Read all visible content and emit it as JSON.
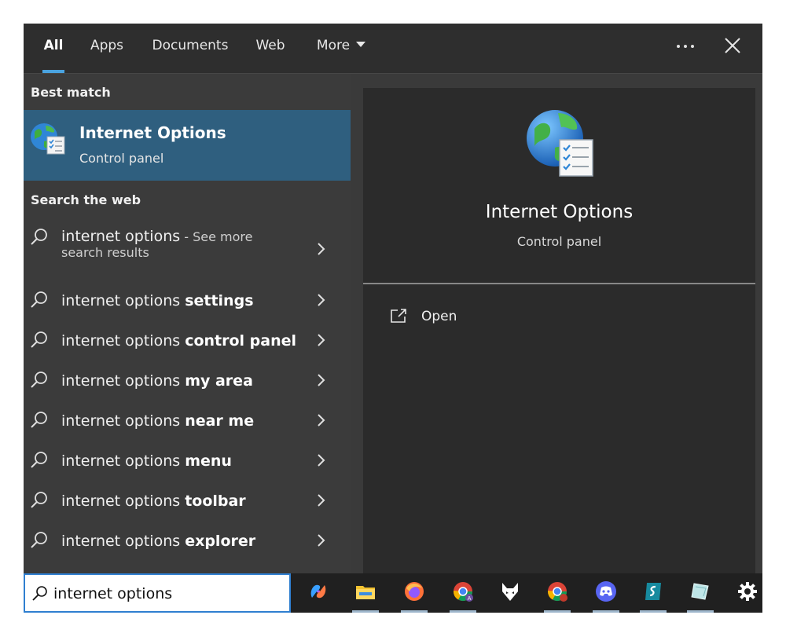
{
  "tabs": [
    {
      "label": "All",
      "active": true
    },
    {
      "label": "Apps"
    },
    {
      "label": "Documents"
    },
    {
      "label": "Web"
    },
    {
      "label": "More"
    }
  ],
  "sections": {
    "best_match": "Best match",
    "search_web": "Search the web"
  },
  "best_match": {
    "title": "Internet Options",
    "subtitle": "Control panel",
    "icon": "internet-options-icon"
  },
  "web_results": [
    {
      "prefix": "internet options",
      "bold": "",
      "suffix": " - See more",
      "line2": "search results"
    },
    {
      "prefix": "internet options ",
      "bold": "settings"
    },
    {
      "prefix": "internet options ",
      "bold": "control panel"
    },
    {
      "prefix": "internet options ",
      "bold": "my area"
    },
    {
      "prefix": "internet options ",
      "bold": "near me"
    },
    {
      "prefix": "internet options ",
      "bold": "menu"
    },
    {
      "prefix": "internet options ",
      "bold": "toolbar"
    },
    {
      "prefix": "internet options ",
      "bold": "explorer"
    }
  ],
  "preview": {
    "title": "Internet Options",
    "subtitle": "Control panel",
    "actions": [
      {
        "label": "Open",
        "icon": "open-external-icon"
      }
    ]
  },
  "search": {
    "value": "internet options"
  },
  "taskbar_apps": [
    "copilot-icon",
    "file-explorer-icon",
    "firefox-icon",
    "chrome-profile-a-icon",
    "foxy-icon",
    "chrome-profile-b-icon",
    "discord-icon",
    "surfshark-icon",
    "glass-app-icon",
    "settings-icon"
  ],
  "colors": {
    "accent": "#4aa3df",
    "selected_bg": "#2f5f7f",
    "panel_bg": "#3b3b3b",
    "preview_bg": "#2b2b2b",
    "taskbar_bg": "#202020"
  }
}
